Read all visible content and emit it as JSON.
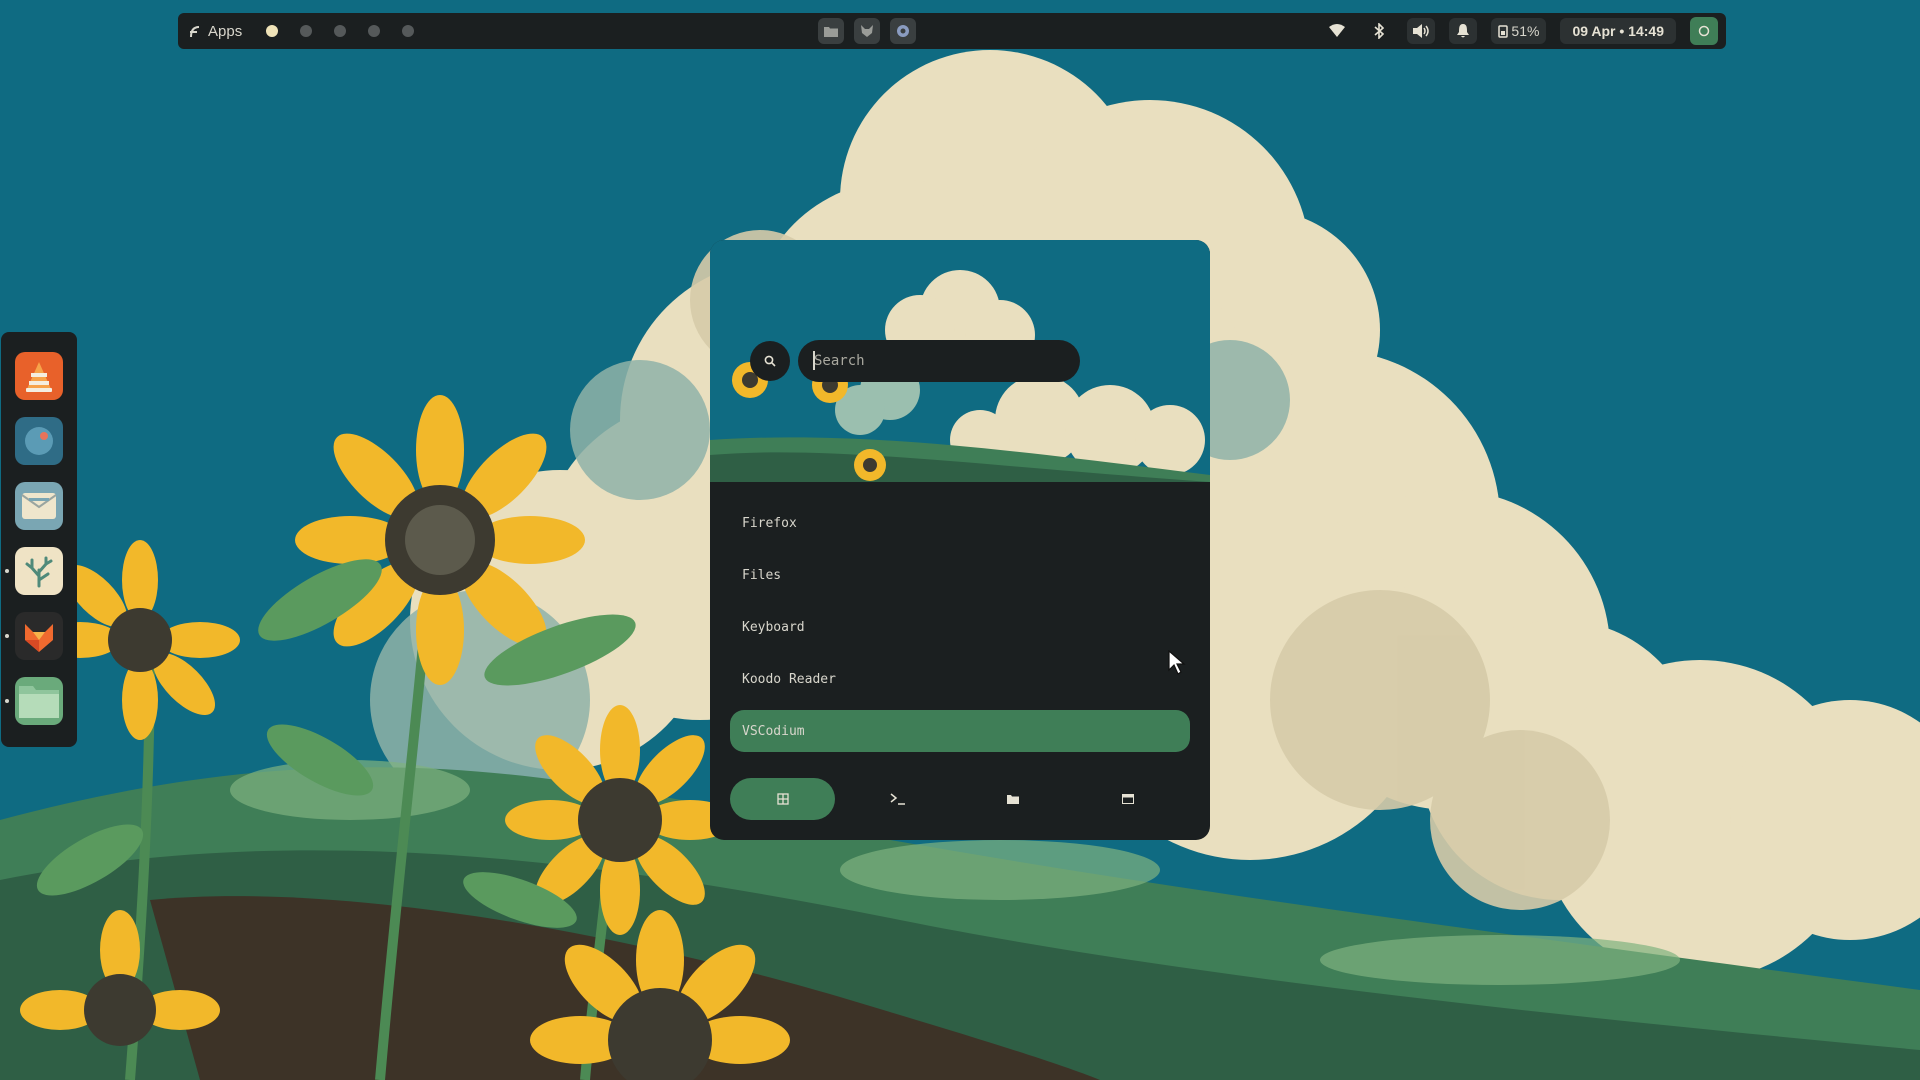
{
  "topbar": {
    "apps_label": "Apps",
    "workspaces": [
      {
        "active": true
      },
      {
        "active": false
      },
      {
        "active": false
      },
      {
        "active": false
      },
      {
        "active": false
      }
    ],
    "center_icons": [
      "folder-icon",
      "fox-icon",
      "gear-icon"
    ],
    "battery_percent": "51%",
    "clock": "09 Apr • 14:49"
  },
  "dock": {
    "apps": [
      {
        "name": "vlc",
        "running": false
      },
      {
        "name": "compass",
        "running": false
      },
      {
        "name": "mail",
        "running": false
      },
      {
        "name": "coral",
        "running": true
      },
      {
        "name": "firefox",
        "running": true
      },
      {
        "name": "files",
        "running": true
      }
    ]
  },
  "launcher": {
    "search_placeholder": "Search",
    "apps": [
      "Firefox",
      "Files",
      "Keyboard",
      "Koodo Reader",
      "VSCodium"
    ],
    "selected_index": 4,
    "modes": [
      {
        "icon": "grid-icon",
        "glyph": "⊞",
        "active": true
      },
      {
        "icon": "terminal-icon",
        "glyph": "›_",
        "active": false
      },
      {
        "icon": "folder-icon",
        "glyph": "",
        "active": false
      },
      {
        "icon": "window-icon",
        "glyph": "",
        "active": false
      }
    ]
  },
  "colors": {
    "accent": "#3f7e57",
    "panel": "#1b1f20",
    "sky": "#0f6b82",
    "text": "#d8d6cc"
  }
}
